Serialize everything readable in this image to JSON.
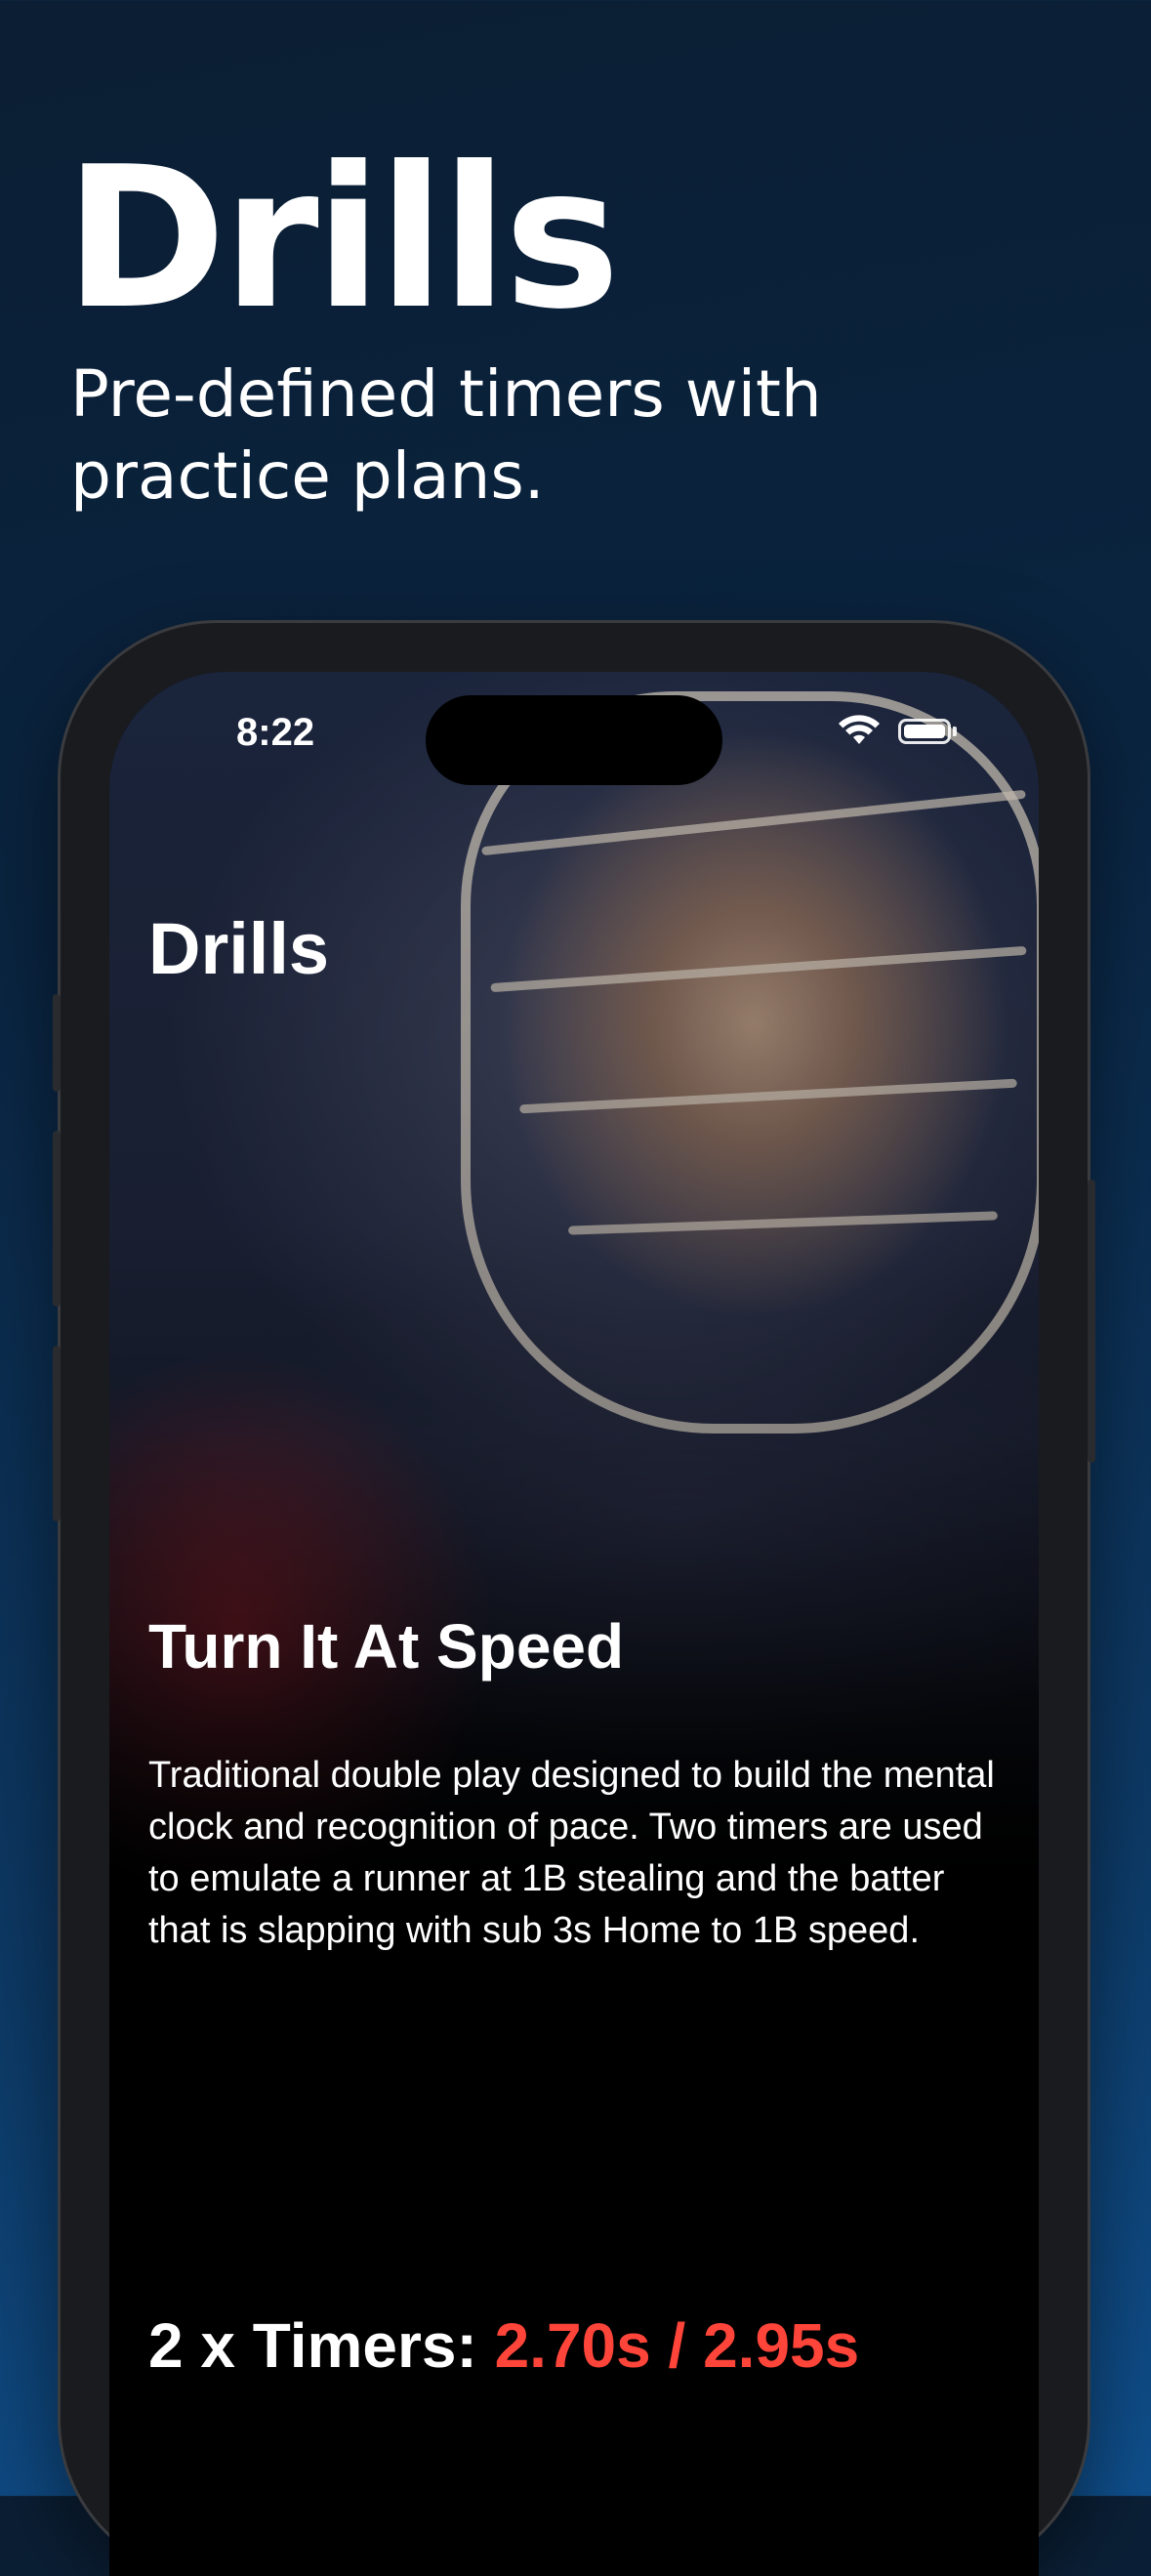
{
  "hero": {
    "title": "Drills",
    "subtitle": "Pre-defined timers with practice plans."
  },
  "status_bar": {
    "time": "8:22",
    "icons": [
      "wifi-icon",
      "battery-icon"
    ]
  },
  "screen": {
    "title": "Drills",
    "drill": {
      "name": "Turn It At Speed",
      "description": "Traditional double play designed to build the mental clock and recognition of pace. Two timers are used to emulate a runner at 1B stealing and the batter that is slapping with sub 3s Home to 1B speed.",
      "timers_label": "2 x Timers:",
      "timers_value": "2.70s / 2.95s"
    }
  },
  "colors": {
    "accent_red": "#ff453a",
    "background_top": "#0b1e33",
    "background_bottom": "#0f4f8c"
  }
}
